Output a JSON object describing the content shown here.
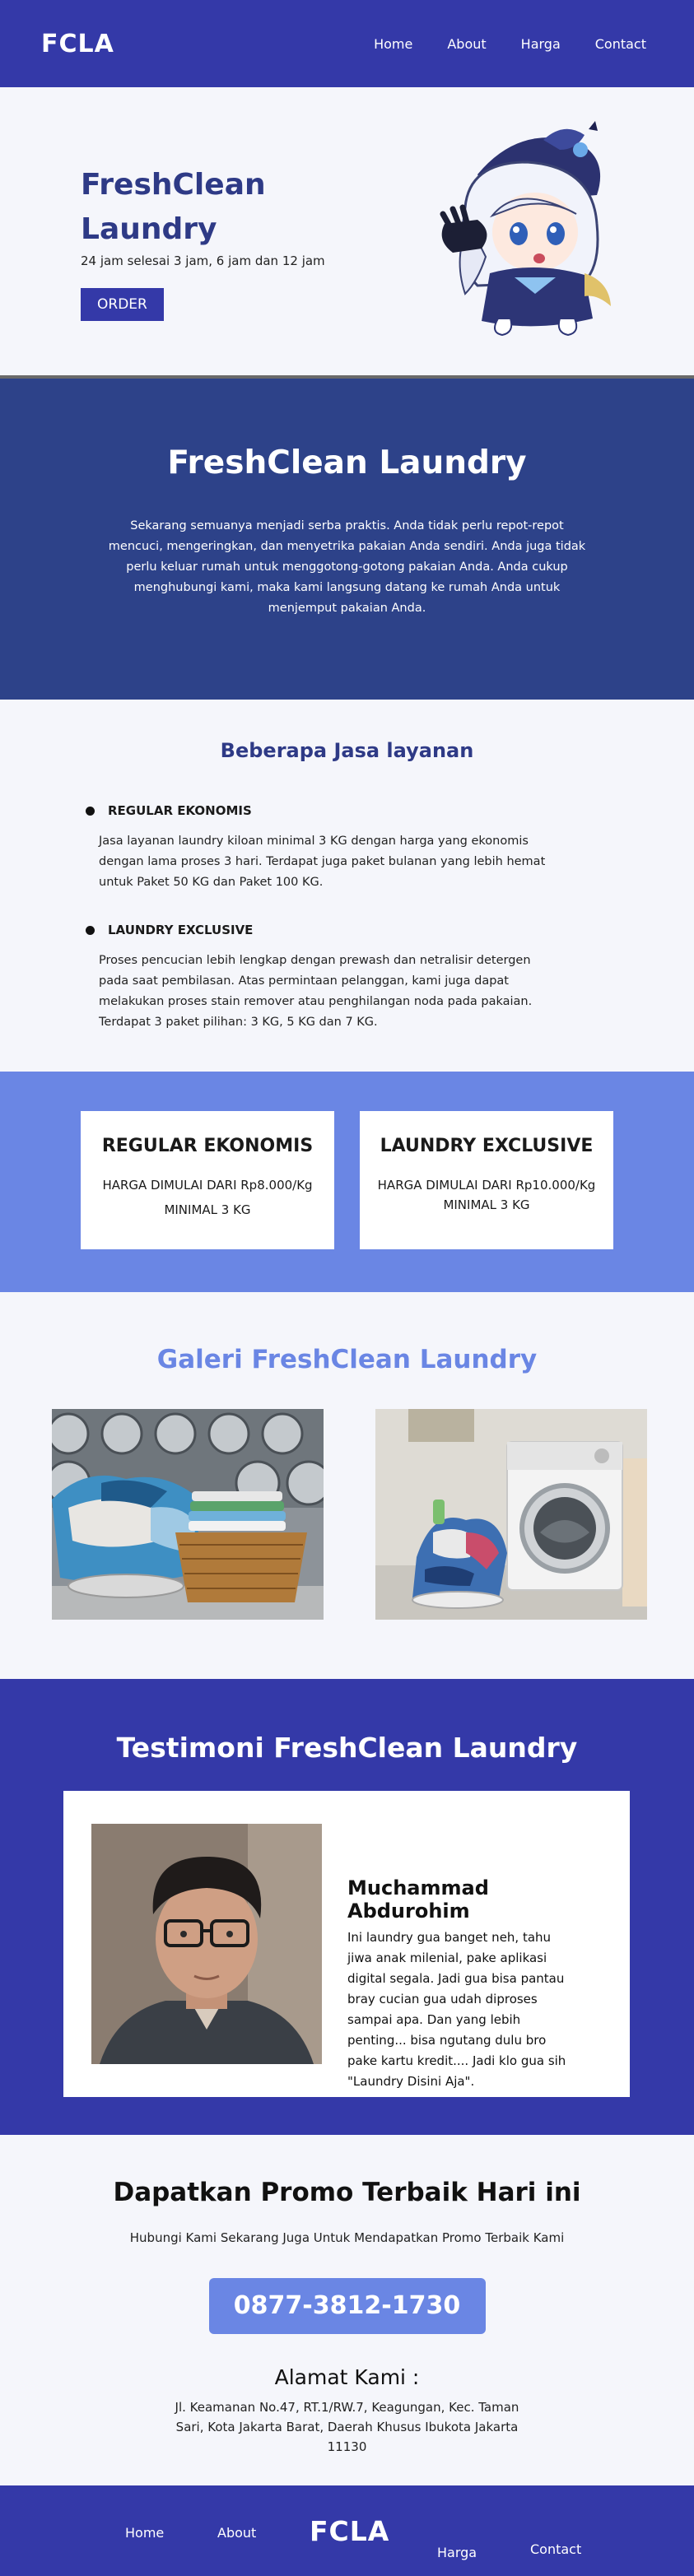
{
  "header": {
    "brand": "FCLA",
    "nav": [
      "Home",
      "About",
      "Harga",
      "Contact"
    ]
  },
  "hero": {
    "title": "FreshClean Laundry",
    "subtitle": "24 jam selesai 3 jam, 6 jam dan 12 jam",
    "order_label": "ORDER"
  },
  "about": {
    "title": "FreshClean Laundry",
    "text": "Sekarang semuanya menjadi serba praktis. Anda tidak perlu repot-repot mencuci, mengeringkan, dan menyetrika pakaian Anda sendiri. Anda juga tidak perlu keluar rumah untuk menggotong-gotong pakaian Anda. Anda cukup menghubungi kami, maka kami langsung datang ke rumah Anda untuk menjemput pakaian Anda."
  },
  "services": {
    "title": "Beberapa Jasa layanan",
    "items": [
      {
        "name": "REGULAR EKONOMIS",
        "desc": "Jasa layanan laundry kiloan minimal 3 KG dengan harga yang ekonomis dengan lama proses 3 hari. Terdapat juga paket bulanan yang lebih hemat untuk Paket 50 KG dan Paket 100 KG."
      },
      {
        "name": "LAUNDRY EXCLUSIVE",
        "desc": "Proses pencucian lebih lengkap dengan prewash dan netralisir detergen pada saat pembilasan. Atas permintaan pelanggan, kami juga dapat melakukan proses stain remover atau penghilangan noda pada pakaian. Terdapat 3 paket pilihan: 3 KG, 5 KG dan 7 KG."
      }
    ]
  },
  "pricing": [
    {
      "name": "REGULAR EKONOMIS",
      "price": "HARGA DIMULAI DARI  Rp8.000/Kg",
      "min": "MINIMAL 3 KG"
    },
    {
      "name": "LAUNDRY EXCLUSIVE",
      "price": "HARGA DIMULAI DARI  Rp10.000/Kg",
      "min": "MINIMAL 3 KG"
    }
  ],
  "gallery": {
    "title": "Galeri FreshClean Laundry"
  },
  "testimonial": {
    "title": "Testimoni FreshClean Laundry",
    "name": "Muchammad Abdurohim",
    "quote": "Ini laundry gua banget neh, tahu jiwa anak milenial, pake aplikasi digital segala. Jadi gua bisa pantau bray cucian gua udah diproses sampai apa. Dan yang lebih penting... bisa ngutang dulu bro pake kartu kredit.... Jadi klo gua sih \"Laundry Disini Aja\"."
  },
  "contact": {
    "title": "Dapatkan Promo Terbaik Hari ini",
    "subtitle": "Hubungi Kami Sekarang Juga Untuk Mendapatkan Promo Terbaik Kami",
    "phone": "0877-3812-1730",
    "address_title": "Alamat Kami :",
    "address": "Jl. Keamanan No.47, RT.1/RW.7, Keagungan, Kec. Taman Sari, Kota Jakarta Barat, Daerah Khusus Ibukota Jakarta 11130"
  },
  "footer": {
    "brand": "FCLA",
    "nav": [
      "Home",
      "About",
      "Harga",
      "Contact"
    ]
  },
  "colors": {
    "navy": "#3439a8",
    "about_bg": "#2d4289",
    "accent_blue": "#6a86e4",
    "heading_blue": "#2e3a86",
    "page_bg": "#f5f6fb"
  }
}
